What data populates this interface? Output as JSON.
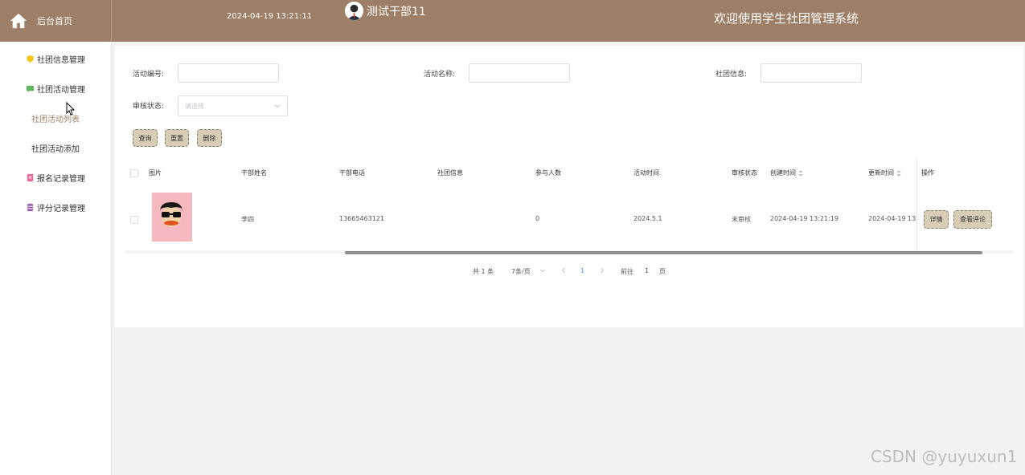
{
  "header": {
    "home_label": "后台首页",
    "datetime": "2024-04-19 13:21:11",
    "username": "测试干部11",
    "welcome": "欢迎使用学生社团管理系统"
  },
  "sidebar": {
    "items": [
      {
        "label": "社团信息管理",
        "icon": "shield-icon",
        "color": "#f2c81d"
      },
      {
        "label": "社团活动管理",
        "icon": "chat-icon",
        "color": "#5db85b"
      },
      {
        "label": "社团活动列表"
      },
      {
        "label": "社团活动添加"
      },
      {
        "label": "报名记录管理",
        "icon": "clipboard-icon",
        "color": "#e8689b"
      },
      {
        "label": "评分记录管理",
        "icon": "database-icon",
        "color": "#9b5fb4"
      }
    ]
  },
  "filters": {
    "activity_no_label": "活动编号:",
    "activity_name_label": "活动名称:",
    "club_info_label": "社团信息:",
    "audit_status_label": "审核状态:",
    "audit_status_placeholder": "请选择"
  },
  "actions": {
    "query": "查询",
    "reset": "重置",
    "delete": "删除"
  },
  "table": {
    "columns": [
      "图片",
      "干部姓名",
      "干部电话",
      "社团信息",
      "参与人数",
      "活动时间",
      "审核状态",
      "创建时间",
      "更新时间",
      "操作"
    ],
    "rows": [
      {
        "name": "李四",
        "phone": "13665463121",
        "club_info": "",
        "participants": "0",
        "activity_time": "2024.5.1",
        "audit_status": "未审核",
        "created": "2024-04-19 13:21:19",
        "updated": "2024-04-19 13",
        "detail_btn": "详情",
        "comment_btn": "查看评论"
      }
    ]
  },
  "pagination": {
    "total": "共 1 条",
    "page_size": "7条/页",
    "current": "1",
    "goto_label": "前往",
    "goto_value": "1",
    "page_unit": "页"
  },
  "watermark": "CSDN @yuyuxun1",
  "colors": {
    "header_bg": "#9c7f66",
    "button_bg": "#d8cdb6",
    "active_menu": "#9c7f66"
  }
}
